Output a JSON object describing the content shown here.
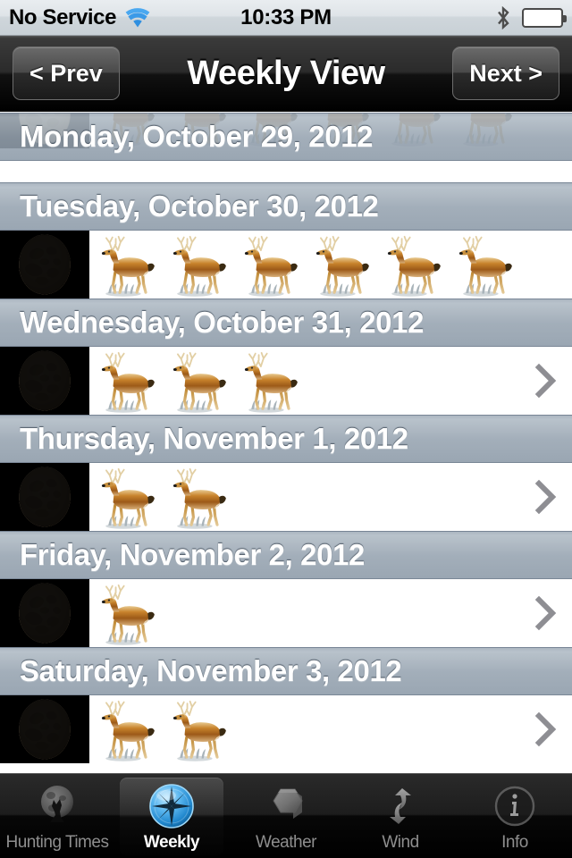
{
  "status_bar": {
    "carrier": "No Service",
    "time": "10:33 PM",
    "wifi_icon": "wifi-icon",
    "bluetooth_icon": "bluetooth-icon",
    "battery_icon": "battery-icon",
    "battery_level_pct": 100
  },
  "nav_bar": {
    "title": "Weekly View",
    "prev_label": "< Prev",
    "next_label": "Next >"
  },
  "colors": {
    "section_header": "#9aa7b5",
    "nav_bar": "#000000",
    "row_bg": "#ffffff",
    "chevron": "#8e8e93",
    "tab_selected": "#ffffff",
    "tab_unselected": "#8e8e8e",
    "compass_blue": "#3fa9f5"
  },
  "days": [
    {
      "header": "Monday, October 29, 2012",
      "deer_count": 6,
      "moon_phase": "full-moon",
      "moon_illumination": 1.0,
      "has_chevron": false,
      "clipped": true
    },
    {
      "header": "Tuesday, October 30, 2012",
      "deer_count": 6,
      "moon_phase": "waning-gibbous",
      "moon_illumination": 0.97,
      "has_chevron": false,
      "clipped": false
    },
    {
      "header": "Wednesday, October 31, 2012",
      "deer_count": 3,
      "moon_phase": "waning-gibbous",
      "moon_illumination": 0.92,
      "has_chevron": true,
      "clipped": false
    },
    {
      "header": "Thursday, November 1, 2012",
      "deer_count": 2,
      "moon_phase": "waning-gibbous",
      "moon_illumination": 0.85,
      "has_chevron": true,
      "clipped": false
    },
    {
      "header": "Friday, November 2, 2012",
      "deer_count": 1,
      "moon_phase": "waning-gibbous",
      "moon_illumination": 0.78,
      "has_chevron": true,
      "clipped": false
    },
    {
      "header": "Saturday, November 3, 2012",
      "deer_count": 2,
      "moon_phase": "waning-gibbous",
      "moon_illumination": 0.7,
      "has_chevron": true,
      "clipped": false
    }
  ],
  "tab_bar": {
    "selected_index": 1,
    "tabs": [
      {
        "label": "Hunting Times",
        "icon": "moon-wolf-icon"
      },
      {
        "label": "Weekly",
        "icon": "compass-rose-icon"
      },
      {
        "label": "Weather",
        "icon": "hexagon-cloud-icon"
      },
      {
        "label": "Wind",
        "icon": "wind-arrows-icon"
      },
      {
        "label": "Info",
        "icon": "info-circle-icon"
      }
    ]
  }
}
